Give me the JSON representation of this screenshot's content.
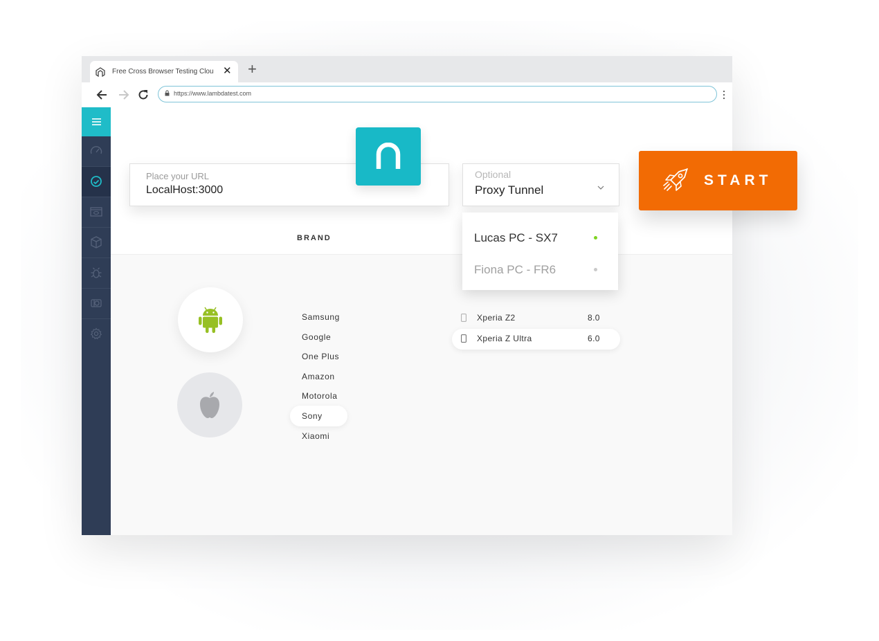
{
  "browser": {
    "tab_title": "Free Cross Browser Testing Cloud",
    "url": "https://www.lambdatest.com"
  },
  "sidebar": {
    "items": [
      {
        "icon": "speedometer-icon"
      },
      {
        "icon": "realtime-sync-icon",
        "active": true
      },
      {
        "icon": "screenshot-window-icon"
      },
      {
        "icon": "cube-icon"
      },
      {
        "icon": "bug-icon"
      },
      {
        "icon": "integration-icon"
      },
      {
        "icon": "gear-icon"
      }
    ]
  },
  "url_input": {
    "label": "Place your URL",
    "value": "LocalHost:3000"
  },
  "proxy": {
    "label": "Optional",
    "value": "Proxy Tunnel",
    "options": [
      {
        "label": "Lucas PC - SX7",
        "status_color": "#7ed321"
      },
      {
        "label": "Fiona PC - FR6",
        "status_color": "#c9c9c9"
      }
    ]
  },
  "start_button": {
    "label": "START"
  },
  "brand_header": "BRAND",
  "os_options": [
    "android-icon",
    "apple-icon"
  ],
  "brands": [
    "Samsung",
    "Google",
    "One Plus",
    "Amazon",
    "Motorola",
    "Sony",
    "Xiaomi"
  ],
  "selected_brand": "Sony",
  "devices": [
    {
      "name": "Xperia Z2",
      "version": "8.0"
    },
    {
      "name": "Xperia Z Ultra",
      "version": "6.0"
    }
  ],
  "colors": {
    "accent": "#18b9c7",
    "start": "#f26b04",
    "sidebar": "#2f3d56"
  }
}
